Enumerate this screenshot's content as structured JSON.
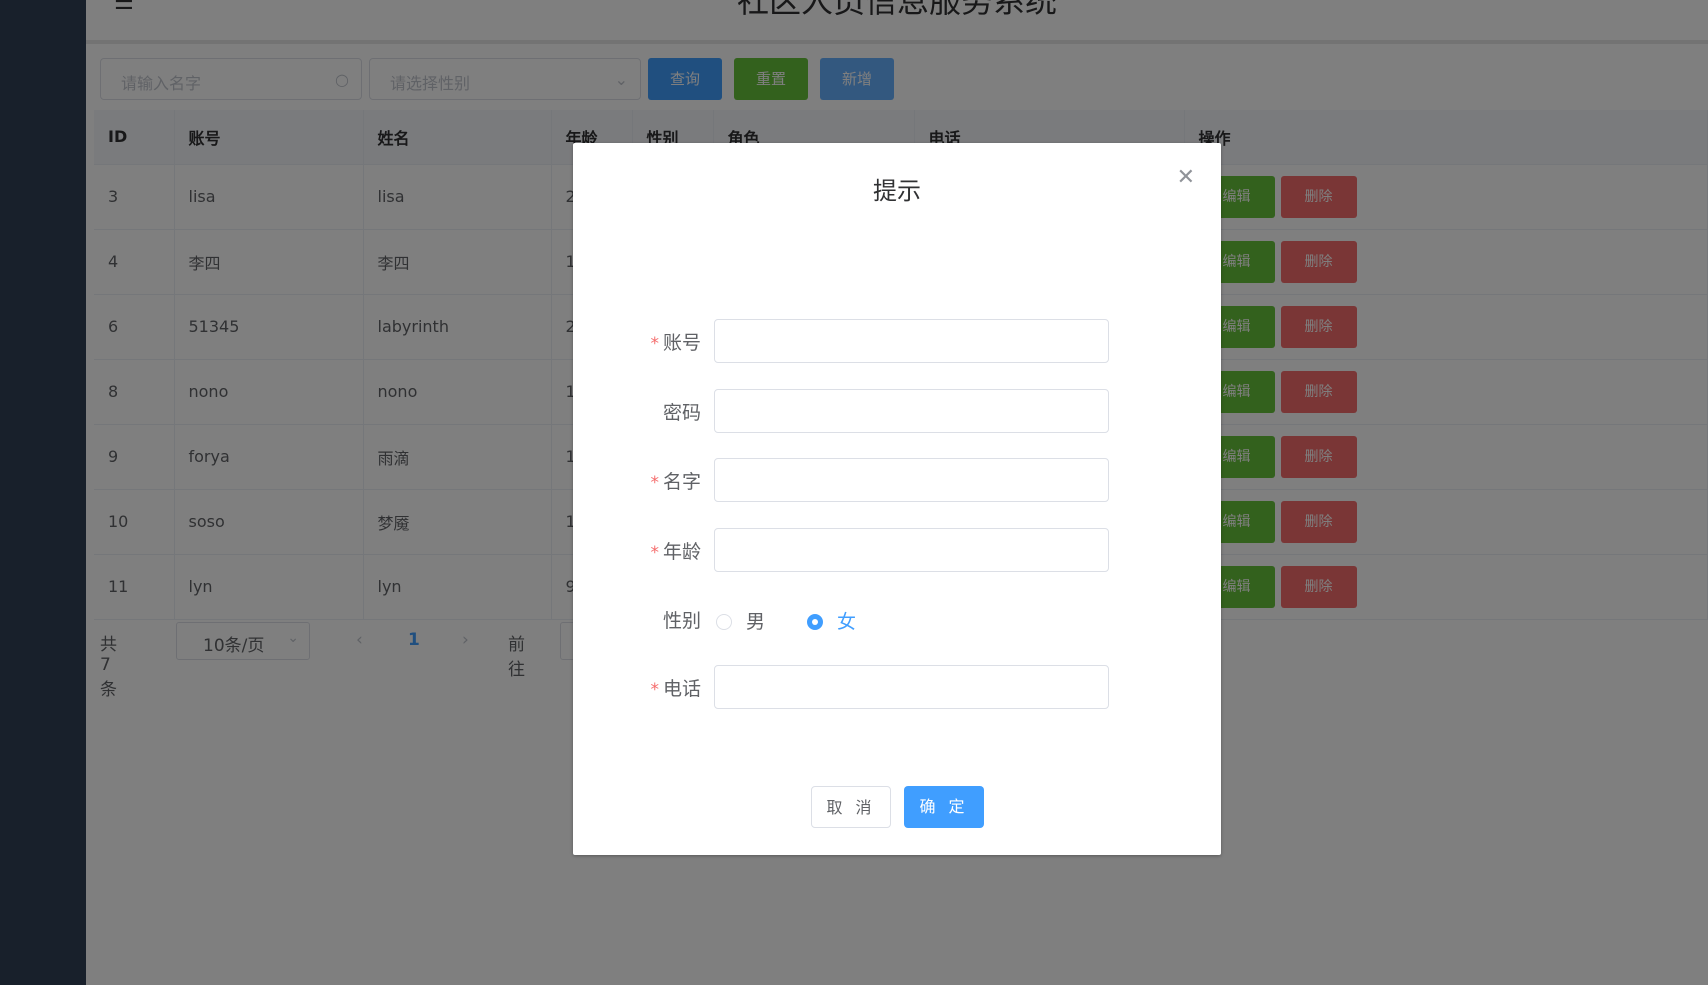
{
  "header": {
    "title": "社区人员信息服务系统",
    "menu_icon": "☰"
  },
  "toolbar": {
    "name_placeholder": "请输入名字",
    "gender_placeholder": "请选择性别",
    "search_label": "查询",
    "reset_label": "重置",
    "add_label": "新增"
  },
  "table": {
    "columns": [
      "ID",
      "账号",
      "姓名",
      "年龄",
      "性别",
      "角色",
      "电话",
      "操作"
    ],
    "rows": [
      {
        "id": "3",
        "account": "lisa",
        "name": "lisa",
        "age": "2"
      },
      {
        "id": "4",
        "account": "李四",
        "name": "李四",
        "age": "1"
      },
      {
        "id": "6",
        "account": "51345",
        "name": "labyrinth",
        "age": "2"
      },
      {
        "id": "8",
        "account": "nono",
        "name": "nono",
        "age": "1"
      },
      {
        "id": "9",
        "account": "forya",
        "name": "雨滴",
        "age": "1"
      },
      {
        "id": "10",
        "account": "soso",
        "name": "梦魇",
        "age": "1"
      },
      {
        "id": "11",
        "account": "lyn",
        "name": "lyn",
        "age": "9"
      }
    ],
    "edit_label": "编辑",
    "delete_label": "删除"
  },
  "pagination": {
    "total": "共 7 条",
    "page_size": "10条/页",
    "current_page": "1",
    "goto_label": "前往"
  },
  "dialog": {
    "title": "提示",
    "fields": {
      "account": "账号",
      "password": "密码",
      "name": "名字",
      "age": "年龄",
      "gender": "性别",
      "phone": "电话"
    },
    "required_mark": "*",
    "gender_options": [
      "男",
      "女"
    ],
    "gender_selected": "女",
    "cancel_label": "取 消",
    "confirm_label": "确 定"
  },
  "colors": {
    "primary": "#409eff",
    "success": "#67c23a",
    "danger": "#f56c6c",
    "sidebar": "#304156"
  }
}
